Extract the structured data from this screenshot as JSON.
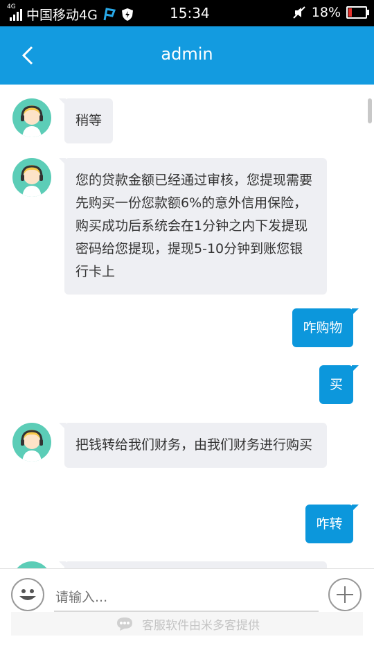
{
  "status_bar": {
    "network_small": "4G",
    "carrier": "中国移动4G",
    "time": "15:34",
    "battery": "18%",
    "battery_level": 0.18
  },
  "header": {
    "title": "admin"
  },
  "messages": [
    {
      "side": "left",
      "text": "稍等"
    },
    {
      "side": "left",
      "text": "您的贷款金额已经通过审核，您提现需要先购买一份您款额6%的意外信用保险，购买成功后系统会在1分钟之内下发提现密码给您提现，提现5-10分钟到账您银行卡上"
    },
    {
      "side": "right",
      "text": "咋购物"
    },
    {
      "side": "right",
      "text": "买"
    },
    {
      "side": "left",
      "text": "把钱转给我们财务，由我们财务进行购买"
    },
    {
      "side": "right",
      "text": "咋转"
    }
  ],
  "input": {
    "placeholder": "请输入..."
  },
  "footer": {
    "text": "客服软件由米多客提供"
  },
  "colors": {
    "accent": "#139be0",
    "bubble_right": "#0c97dc",
    "bubble_left": "#eeeff3"
  }
}
